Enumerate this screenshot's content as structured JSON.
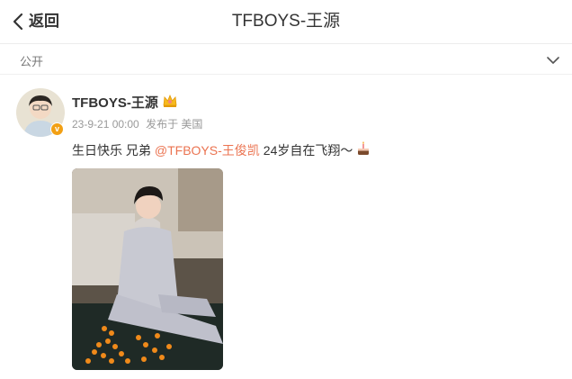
{
  "header": {
    "back_label": "返回",
    "title": "TFBOYS-王源",
    "back_icon": "chevron-left-icon"
  },
  "visibility": {
    "label": "公开",
    "icon": "chevron-down-icon"
  },
  "post": {
    "author": "TFBOYS-王源",
    "author_badge_icon": "crown-icon",
    "verified_icon": "verified-v-icon",
    "verified_color": "#f2a014",
    "timestamp": "23-9-21 00:00",
    "source": "发布于 美国",
    "text_prefix": "生日快乐 兄弟",
    "mention": "@TFBOYS-王俊凯",
    "text_suffix": "24岁自在飞翔～",
    "emoji_icon": "birthday-cake-icon",
    "mention_color": "#eb7350"
  },
  "image": {
    "description_icon": "photo-icon"
  }
}
